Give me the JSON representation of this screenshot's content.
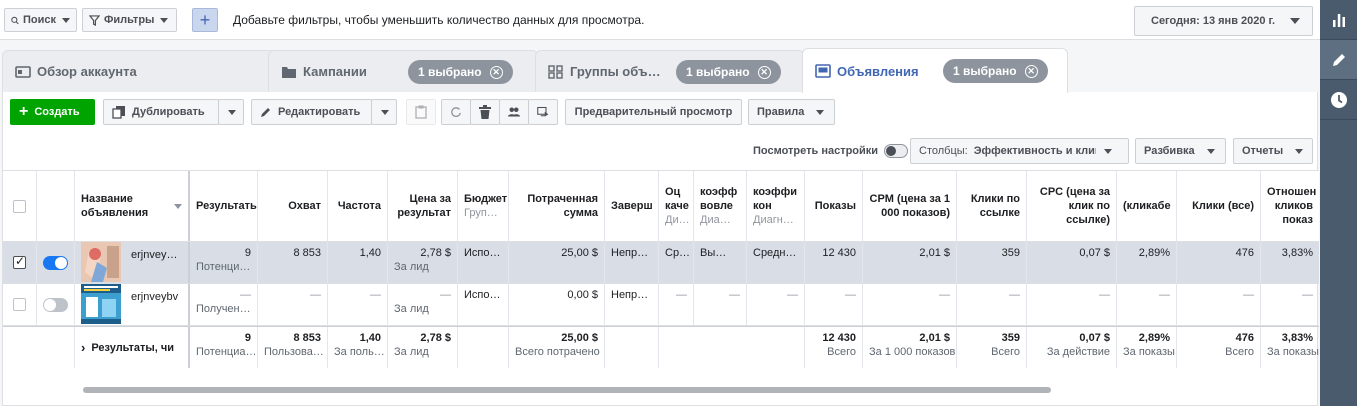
{
  "topbar": {
    "search_label": "Поиск",
    "filters_label": "Фильтры",
    "add_symbol": "+",
    "hint": "Добавьте фильтры, чтобы уменьшить количество данных для просмотра.",
    "date_label": "Сегодня: 13 янв 2020 г."
  },
  "tabs": {
    "account": "Обзор аккаунта",
    "campaigns": "Кампании",
    "adsets": "Группы объ…",
    "ads": "Объявления",
    "selected": "1 выбрано",
    "close_symbol": "✕"
  },
  "toolbar": {
    "create": "Создать",
    "duplicate": "Дублировать",
    "edit": "Редактировать",
    "preview": "Предварительный просмотр",
    "rules": "Правила",
    "view_settings": "Посмотреть настройки",
    "columns_prefix": "Столбцы:",
    "columns_value": "Эффективность и клик",
    "breakdown": "Разбивка",
    "reports": "Отчеты"
  },
  "table": {
    "headers": {
      "name": "Название объявления",
      "results": "Результаты",
      "reach": "Охват",
      "frequency": "Частота",
      "cost_per_result": "Цена за результат",
      "budget": "Бюджет",
      "budget_sub": "Груп…",
      "spent": "Потраченная сумма",
      "ends": "Заверш",
      "quality": "Оц каче",
      "quality_sub": "Ди…",
      "engagement": "коэфф вовле",
      "engagement_sub": "Диа…",
      "conversion": "коэффи кон",
      "conversion_sub": "Диагн…",
      "impressions": "Показы",
      "cpm": "CPM (цена за 1 000 показов)",
      "link_clicks": "Клики по ссылке",
      "cpc": "CPC (цена за клик по ссылке)",
      "ctr": "(кликабе",
      "clicks_all": "Клики (все)",
      "ratio": "Отношен кликов показ"
    },
    "rows": [
      {
        "name": "erjnvey…",
        "results": "9",
        "results_sub": "Потенци…",
        "reach": "8 853",
        "frequency": "1,40",
        "cost_per_result": "2,78 $",
        "cost_sub": "За лид",
        "budget": "Испо…",
        "spent": "25,00 $",
        "ends": "Непр…",
        "quality": "Ср…",
        "engagement": "Вы…",
        "conversion": "Средн…",
        "impressions": "12 430",
        "cpm": "2,01 $",
        "link_clicks": "359",
        "cpc": "0,07 $",
        "ctr": "2,89%",
        "clicks_all": "476",
        "ratio": "3,83%"
      },
      {
        "name": "erjnveybv",
        "results": "—",
        "results_sub": "Получен…",
        "reach": "—",
        "frequency": "—",
        "cost_per_result": "—",
        "cost_sub": "За лид",
        "budget": "Испо…",
        "spent": "0,00 $",
        "ends": "Непр…",
        "quality": "—",
        "engagement": "—",
        "conversion": "—",
        "impressions": "—",
        "cpm": "—",
        "link_clicks": "—",
        "cpc": "—",
        "ctr": "—",
        "clicks_all": "—",
        "ratio": "—"
      }
    ],
    "totals": {
      "label": "Результаты, чи",
      "results": "9",
      "results_sub": "Потенциа…",
      "reach": "8 853",
      "reach_sub": "Пользова…",
      "frequency": "1,40",
      "frequency_sub": "За поль…",
      "cost_per_result": "2,78 $",
      "cost_sub": "За лид",
      "spent": "25,00 $",
      "spent_sub": "Всего потрачено",
      "impressions": "12 430",
      "impressions_sub": "Всего",
      "cpm": "2,01 $",
      "cpm_sub": "За 1 000 показов",
      "link_clicks": "359",
      "link_clicks_sub": "Всего",
      "cpc": "0,07 $",
      "cpc_sub": "За действие",
      "ctr": "2,89%",
      "ctr_sub": "За показы",
      "clicks_all": "476",
      "clicks_all_sub": "Всего",
      "ratio": "3,83%",
      "ratio_sub": "За показы"
    }
  },
  "colors": {
    "create_green": "#00a400",
    "toggle_blue": "#1877f2",
    "rail_bg": "#4b5b6e",
    "pill_gray": "#8d949e"
  }
}
